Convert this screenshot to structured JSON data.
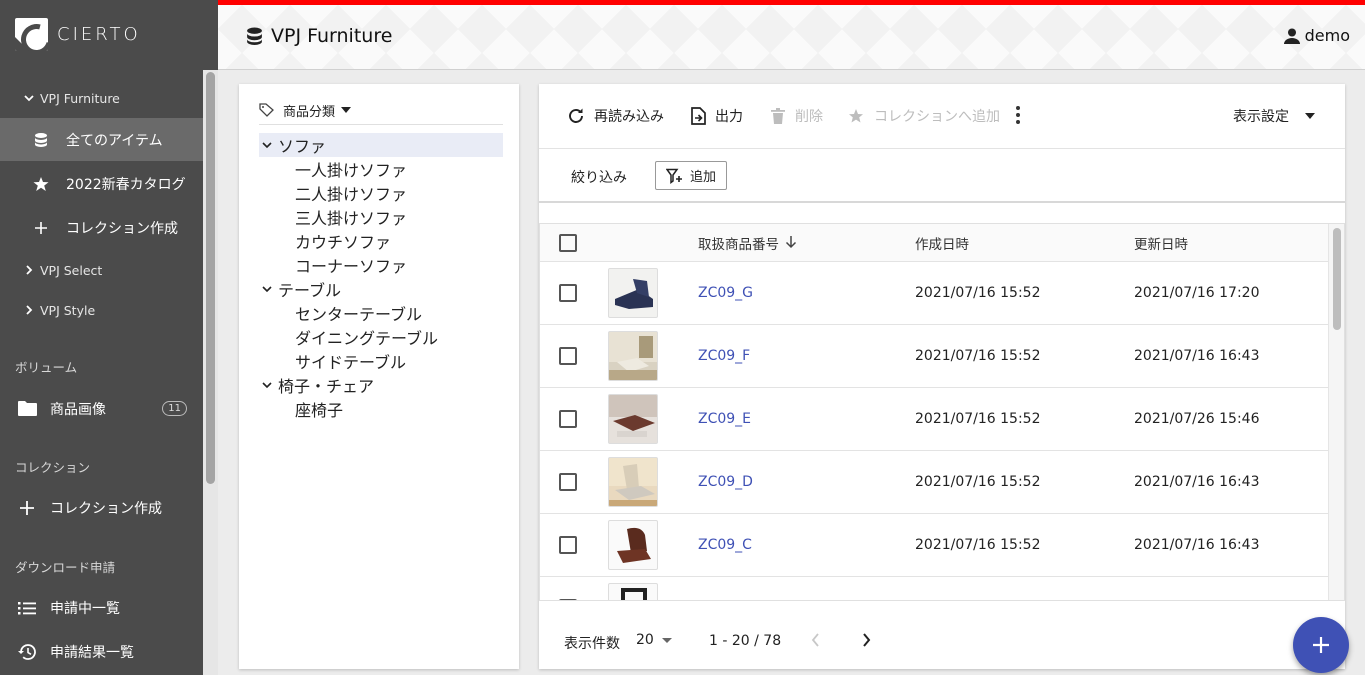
{
  "brand": {
    "name": "CIERTO"
  },
  "header": {
    "title": "VPJ Furniture",
    "user": "demo"
  },
  "sidebar": {
    "groups": [
      {
        "label": "VPJ Furniture",
        "expanded": true
      },
      {
        "label": "VPJ Select",
        "expanded": false
      },
      {
        "label": "VPJ Style",
        "expanded": false
      }
    ],
    "furniture_items": [
      {
        "label": "全てのアイテム",
        "icon": "database-icon",
        "selected": true
      },
      {
        "label": "2022新春カタログ",
        "icon": "star-icon",
        "selected": false
      },
      {
        "label": "コレクション作成",
        "icon": "plus-icon",
        "selected": false
      }
    ],
    "volume_section": "ボリューム",
    "volume_item": {
      "label": "商品画像",
      "count": "11"
    },
    "collection_section": "コレクション",
    "collection_create": "コレクション作成",
    "download_section": "ダウンロード申請",
    "download_items": [
      {
        "label": "申請中一覧",
        "icon": "list-icon"
      },
      {
        "label": "申請結果一覧",
        "icon": "history-icon"
      }
    ]
  },
  "tree": {
    "header": "商品分類",
    "nodes": [
      {
        "label": "ソファ",
        "level": 0,
        "selected": true
      },
      {
        "label": "一人掛けソファ",
        "level": 1
      },
      {
        "label": "二人掛けソファ",
        "level": 1
      },
      {
        "label": "三人掛けソファ",
        "level": 1
      },
      {
        "label": "カウチソファ",
        "level": 1
      },
      {
        "label": "コーナーソファ",
        "level": 1
      },
      {
        "label": "テーブル",
        "level": 0
      },
      {
        "label": "センターテーブル",
        "level": 1
      },
      {
        "label": "ダイニングテーブル",
        "level": 1
      },
      {
        "label": "サイドテーブル",
        "level": 1
      },
      {
        "label": "椅子・チェア",
        "level": 0
      },
      {
        "label": "座椅子",
        "level": 1
      }
    ]
  },
  "toolbar": {
    "reload": "再読み込み",
    "export": "出力",
    "delete": "削除",
    "add_to_collection": "コレクションへ追加",
    "view_settings": "表示設定"
  },
  "filter": {
    "label": "絞り込み",
    "add": "追加"
  },
  "table": {
    "columns": {
      "product_no": "取扱商品番号",
      "created": "作成日時",
      "updated": "更新日時"
    },
    "rows": [
      {
        "product_no": "ZC09_G",
        "created": "2021/07/16 15:52",
        "updated": "2021/07/16 17:20"
      },
      {
        "product_no": "ZC09_F",
        "created": "2021/07/16 15:52",
        "updated": "2021/07/16 16:43"
      },
      {
        "product_no": "ZC09_E",
        "created": "2021/07/16 15:52",
        "updated": "2021/07/26 15:46"
      },
      {
        "product_no": "ZC09_D",
        "created": "2021/07/16 15:52",
        "updated": "2021/07/16 16:43"
      },
      {
        "product_no": "ZC09_C",
        "created": "2021/07/16 15:52",
        "updated": "2021/07/16 16:43"
      }
    ]
  },
  "pagination": {
    "label": "表示件数",
    "page_size": "20",
    "range": "1 - 20 / 78"
  },
  "colors": {
    "accent": "#3f51b5",
    "sidebar": "#4b4b4b",
    "topline": "#ff0000"
  }
}
